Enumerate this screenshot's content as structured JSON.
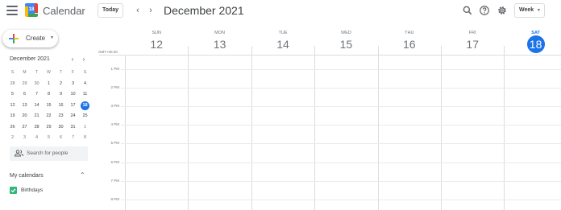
{
  "header": {
    "app_title": "Calendar",
    "logo_number": "18",
    "today_label": "Today",
    "date_title": "December 2021",
    "view_label": "Week",
    "icons": [
      "menu-icon",
      "search-icon",
      "help-icon",
      "settings-icon"
    ]
  },
  "sidebar": {
    "create_label": "Create",
    "mini_cal": {
      "title": "December 2021",
      "weekdays": [
        "S",
        "M",
        "T",
        "W",
        "T",
        "F",
        "S"
      ],
      "weeks": [
        [
          "28",
          "29",
          "30",
          "1",
          "2",
          "3",
          "4"
        ],
        [
          "5",
          "6",
          "7",
          "8",
          "9",
          "10",
          "11"
        ],
        [
          "12",
          "13",
          "14",
          "15",
          "16",
          "17",
          "18"
        ],
        [
          "19",
          "20",
          "21",
          "22",
          "23",
          "24",
          "25"
        ],
        [
          "26",
          "27",
          "28",
          "29",
          "30",
          "31",
          "1"
        ],
        [
          "2",
          "3",
          "4",
          "5",
          "6",
          "7",
          "8"
        ]
      ],
      "today": "18"
    },
    "search_people_placeholder": "Search for people",
    "my_calendars_label": "My calendars",
    "calendars": [
      {
        "label": "Birthdays",
        "color": "#33b679",
        "checked": true
      }
    ]
  },
  "week": {
    "timezone": "GMT+05:30",
    "days": [
      {
        "name": "SUN",
        "date": "12"
      },
      {
        "name": "MON",
        "date": "13"
      },
      {
        "name": "TUE",
        "date": "14"
      },
      {
        "name": "WED",
        "date": "15"
      },
      {
        "name": "THU",
        "date": "16"
      },
      {
        "name": "FRI",
        "date": "17"
      },
      {
        "name": "SAT",
        "date": "18",
        "today": true
      }
    ],
    "hours": [
      "1 PM",
      "2 PM",
      "3 PM",
      "4 PM",
      "5 PM",
      "6 PM",
      "7 PM",
      "8 PM"
    ]
  },
  "colors": {
    "accent": "#1a73e8",
    "birthdays": "#33b679"
  }
}
